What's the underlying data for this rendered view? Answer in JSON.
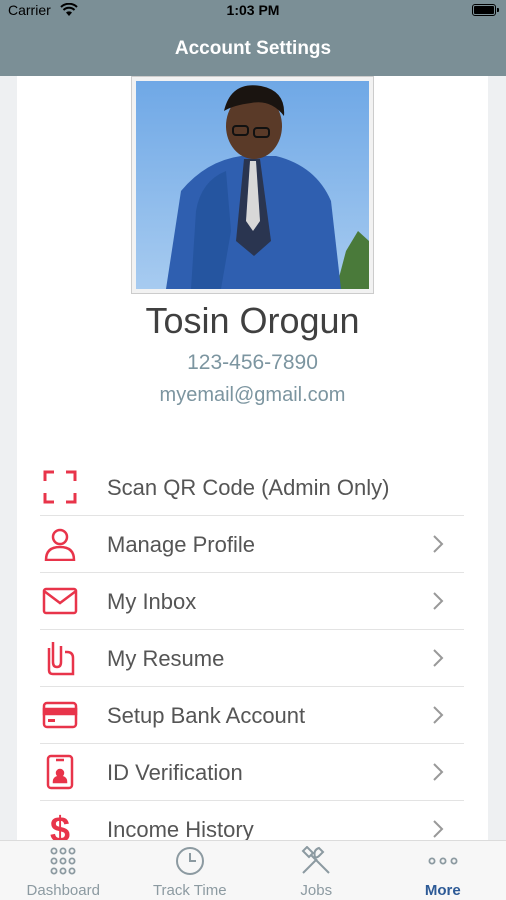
{
  "status_bar": {
    "carrier": "Carrier",
    "time": "1:03 PM"
  },
  "nav": {
    "title": "Account Settings"
  },
  "profile": {
    "name": "Tosin Orogun",
    "phone": "123-456-7890",
    "email": "myemail@gmail.com"
  },
  "menu": {
    "items": [
      {
        "label": "Scan QR Code (Admin Only)",
        "icon": "qr-scan-icon",
        "has_chevron": false
      },
      {
        "label": "Manage Profile",
        "icon": "person-icon",
        "has_chevron": true
      },
      {
        "label": "My Inbox",
        "icon": "envelope-icon",
        "has_chevron": true
      },
      {
        "label": "My Resume",
        "icon": "paperclip-document-icon",
        "has_chevron": true
      },
      {
        "label": "Setup Bank Account",
        "icon": "credit-card-icon",
        "has_chevron": true
      },
      {
        "label": "ID Verification",
        "icon": "id-badge-icon",
        "has_chevron": true
      },
      {
        "label": "Income History",
        "icon": "dollar-icon",
        "has_chevron": true
      }
    ]
  },
  "tabs": [
    {
      "label": "Dashboard",
      "icon": "grid-icon",
      "active": false
    },
    {
      "label": "Track Time",
      "icon": "clock-icon",
      "active": false
    },
    {
      "label": "Jobs",
      "icon": "tools-icon",
      "active": false
    },
    {
      "label": "More",
      "icon": "more-dots-icon",
      "active": true
    }
  ],
  "colors": {
    "header": "#7b8f96",
    "accent_red": "#e8344a",
    "subtle_text": "#7c95a0",
    "active_tab": "#2d5a96"
  }
}
